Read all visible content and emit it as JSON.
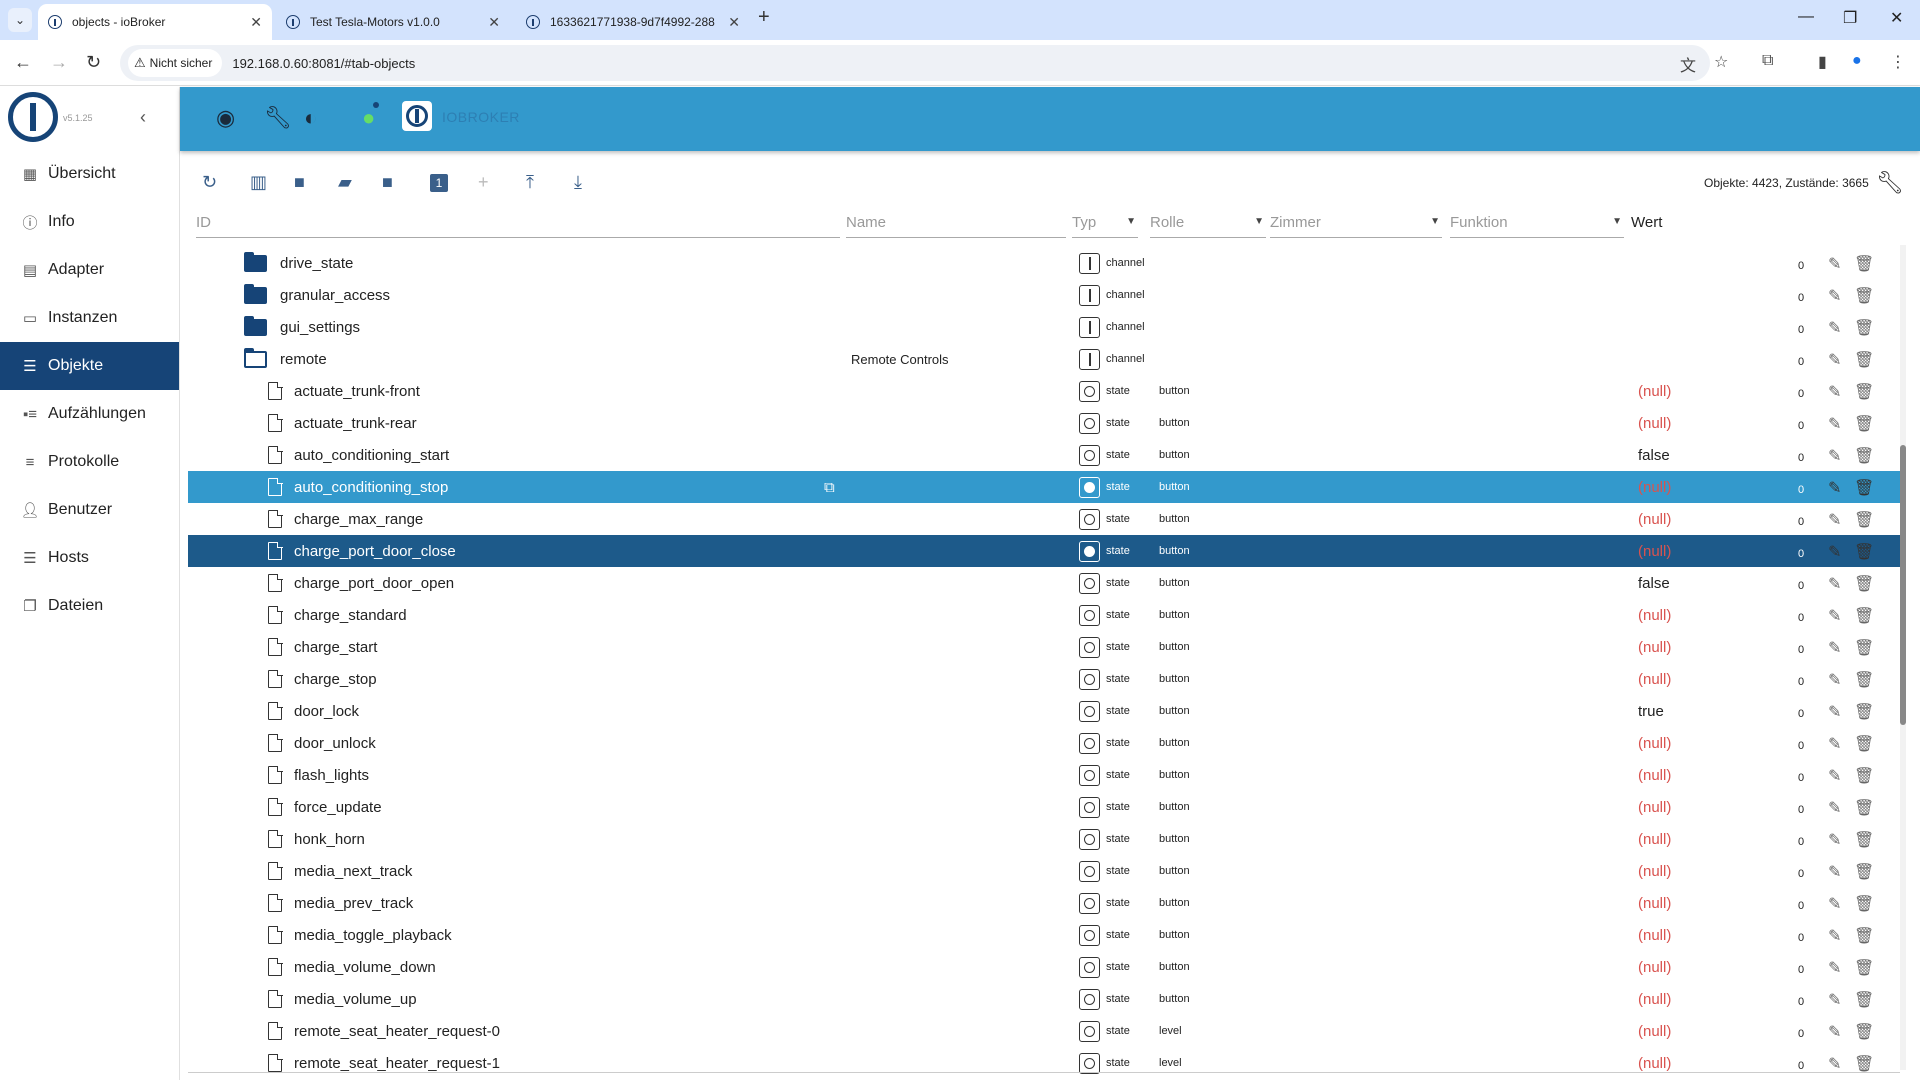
{
  "browser": {
    "tabs": [
      {
        "label": "objects - ioBroker",
        "active": true
      },
      {
        "label": "Test Tesla-Motors v1.0.0",
        "active": false
      },
      {
        "label": "1633621771938-9d7f4992-288",
        "active": false
      }
    ],
    "security_label": "Nicht sicher",
    "url": "192.168.0.60:8081/#tab-objects"
  },
  "sidebar": {
    "version": "v5.1.25",
    "items": [
      {
        "label": "Übersicht",
        "icon": "grid-icon"
      },
      {
        "label": "Info",
        "icon": "info-icon"
      },
      {
        "label": "Adapter",
        "icon": "adapter-icon"
      },
      {
        "label": "Instanzen",
        "icon": "instances-icon"
      },
      {
        "label": "Objekte",
        "icon": "list-icon",
        "active": true
      },
      {
        "label": "Aufzählungen",
        "icon": "enum-icon"
      },
      {
        "label": "Protokolle",
        "icon": "log-icon"
      },
      {
        "label": "Benutzer",
        "icon": "user-icon"
      },
      {
        "label": "Hosts",
        "icon": "hosts-icon"
      },
      {
        "label": "Dateien",
        "icon": "files-icon"
      }
    ]
  },
  "appbar": {
    "brand": "IOBROKER",
    "accent_color": "#3399cc",
    "active_color": "#164477"
  },
  "objects": {
    "stats": "Objekte: 4423, Zustände: 3665",
    "filters": {
      "id": "ID",
      "name": "Name",
      "type": "Typ",
      "role": "Rolle",
      "room": "Zimmer",
      "function": "Funktion",
      "value": "Wert"
    },
    "rows": [
      {
        "kind": "folder",
        "id": "drive_state",
        "name": "",
        "type": "channel",
        "role": "",
        "value": "",
        "count": "0"
      },
      {
        "kind": "folder",
        "id": "granular_access",
        "name": "",
        "type": "channel",
        "role": "",
        "value": "",
        "count": "0"
      },
      {
        "kind": "folder",
        "id": "gui_settings",
        "name": "",
        "type": "channel",
        "role": "",
        "value": "",
        "count": "0"
      },
      {
        "kind": "folder-open",
        "id": "remote",
        "name": "Remote Controls",
        "type": "channel",
        "role": "",
        "value": "",
        "count": "0"
      },
      {
        "kind": "state",
        "id": "actuate_trunk-front",
        "name": "",
        "type": "state",
        "role": "button",
        "value": "(null)",
        "count": "0"
      },
      {
        "kind": "state",
        "id": "actuate_trunk-rear",
        "name": "",
        "type": "state",
        "role": "button",
        "value": "(null)",
        "count": "0"
      },
      {
        "kind": "state",
        "id": "auto_conditioning_start",
        "name": "",
        "type": "state",
        "role": "button",
        "value": "false",
        "count": "0"
      },
      {
        "kind": "state",
        "id": "auto_conditioning_stop",
        "name": "",
        "type": "state",
        "role": "button",
        "value": "(null)",
        "count": "0",
        "highlight": "hover"
      },
      {
        "kind": "state",
        "id": "charge_max_range",
        "name": "",
        "type": "state",
        "role": "button",
        "value": "(null)",
        "count": "0"
      },
      {
        "kind": "state",
        "id": "charge_port_door_close",
        "name": "",
        "type": "state",
        "role": "button",
        "value": "(null)",
        "count": "0",
        "highlight": "selected"
      },
      {
        "kind": "state",
        "id": "charge_port_door_open",
        "name": "",
        "type": "state",
        "role": "button",
        "value": "false",
        "count": "0"
      },
      {
        "kind": "state",
        "id": "charge_standard",
        "name": "",
        "type": "state",
        "role": "button",
        "value": "(null)",
        "count": "0"
      },
      {
        "kind": "state",
        "id": "charge_start",
        "name": "",
        "type": "state",
        "role": "button",
        "value": "(null)",
        "count": "0"
      },
      {
        "kind": "state",
        "id": "charge_stop",
        "name": "",
        "type": "state",
        "role": "button",
        "value": "(null)",
        "count": "0"
      },
      {
        "kind": "state",
        "id": "door_lock",
        "name": "",
        "type": "state",
        "role": "button",
        "value": "true",
        "count": "0"
      },
      {
        "kind": "state",
        "id": "door_unlock",
        "name": "",
        "type": "state",
        "role": "button",
        "value": "(null)",
        "count": "0"
      },
      {
        "kind": "state",
        "id": "flash_lights",
        "name": "",
        "type": "state",
        "role": "button",
        "value": "(null)",
        "count": "0"
      },
      {
        "kind": "state",
        "id": "force_update",
        "name": "",
        "type": "state",
        "role": "button",
        "value": "(null)",
        "count": "0"
      },
      {
        "kind": "state",
        "id": "honk_horn",
        "name": "",
        "type": "state",
        "role": "button",
        "value": "(null)",
        "count": "0"
      },
      {
        "kind": "state",
        "id": "media_next_track",
        "name": "",
        "type": "state",
        "role": "button",
        "value": "(null)",
        "count": "0"
      },
      {
        "kind": "state",
        "id": "media_prev_track",
        "name": "",
        "type": "state",
        "role": "button",
        "value": "(null)",
        "count": "0"
      },
      {
        "kind": "state",
        "id": "media_toggle_playback",
        "name": "",
        "type": "state",
        "role": "button",
        "value": "(null)",
        "count": "0"
      },
      {
        "kind": "state",
        "id": "media_volume_down",
        "name": "",
        "type": "state",
        "role": "button",
        "value": "(null)",
        "count": "0"
      },
      {
        "kind": "state",
        "id": "media_volume_up",
        "name": "",
        "type": "state",
        "role": "button",
        "value": "(null)",
        "count": "0"
      },
      {
        "kind": "state",
        "id": "remote_seat_heater_request-0",
        "name": "",
        "type": "state",
        "role": "level",
        "value": "(null)",
        "count": "0"
      },
      {
        "kind": "state",
        "id": "remote_seat_heater_request-1",
        "name": "",
        "type": "state",
        "role": "level",
        "value": "(null)",
        "count": "0"
      }
    ]
  }
}
